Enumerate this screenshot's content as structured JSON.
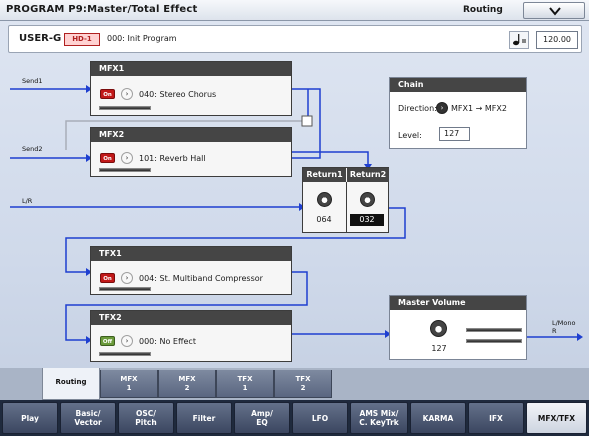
{
  "header": {
    "title": "PROGRAM P9:Master/Total Effect",
    "page": "Routing"
  },
  "program": {
    "bank": "USER-G",
    "type": "HD-1",
    "name": "000: Init Program",
    "tempo": "120.00"
  },
  "routing": {
    "inputs": {
      "send1": "Send1",
      "send2": "Send2",
      "lr": "L/R"
    },
    "output": {
      "line1": "L/Mono",
      "line2": "R"
    },
    "mfx1": {
      "label": "MFX1",
      "state": "On",
      "name": "040: Stereo Chorus"
    },
    "mfx2": {
      "label": "MFX2",
      "state": "On",
      "name": "101: Reverb Hall"
    },
    "tfx1": {
      "label": "TFX1",
      "state": "On",
      "name": "004: St. Multiband Compressor"
    },
    "tfx2": {
      "label": "TFX2",
      "state": "Off",
      "name": "000: No Effect"
    },
    "chain": {
      "title": "Chain",
      "direction_label": "Direction:",
      "direction_value": "MFX1 → MFX2",
      "level_label": "Level:",
      "level_value": "127"
    },
    "returns": {
      "return1_label": "Return1",
      "return1_value": "064",
      "return2_label": "Return2",
      "return2_value": "032"
    },
    "master_volume": {
      "title": "Master Volume",
      "value": "127"
    }
  },
  "tabs": [
    {
      "line1": "Routing",
      "line2": ""
    },
    {
      "line1": "MFX",
      "line2": "1"
    },
    {
      "line1": "MFX",
      "line2": "2"
    },
    {
      "line1": "TFX",
      "line2": "1"
    },
    {
      "line1": "TFX",
      "line2": "2"
    }
  ],
  "nav": [
    {
      "line1": "Play",
      "line2": ""
    },
    {
      "line1": "Basic/",
      "line2": "Vector"
    },
    {
      "line1": "OSC/",
      "line2": "Pitch"
    },
    {
      "line1": "Filter",
      "line2": ""
    },
    {
      "line1": "Amp/",
      "line2": "EQ"
    },
    {
      "line1": "LFO",
      "line2": ""
    },
    {
      "line1": "AMS Mix/",
      "line2": "C. KeyTrk"
    },
    {
      "line1": "KARMA",
      "line2": ""
    },
    {
      "line1": "IFX",
      "line2": ""
    },
    {
      "line1": "MFX/TFX",
      "line2": ""
    }
  ],
  "colors": {
    "signal_line": "#1e3fd0",
    "on_button": "#c11818",
    "off_button": "#6a9a3a",
    "header_bar": "#454545"
  },
  "icons": {
    "page_menu": "chevron-down-icon",
    "tempo": "quarter-note-icon",
    "select": "chevron-right-circle-icon",
    "knob": "knob-icon"
  }
}
